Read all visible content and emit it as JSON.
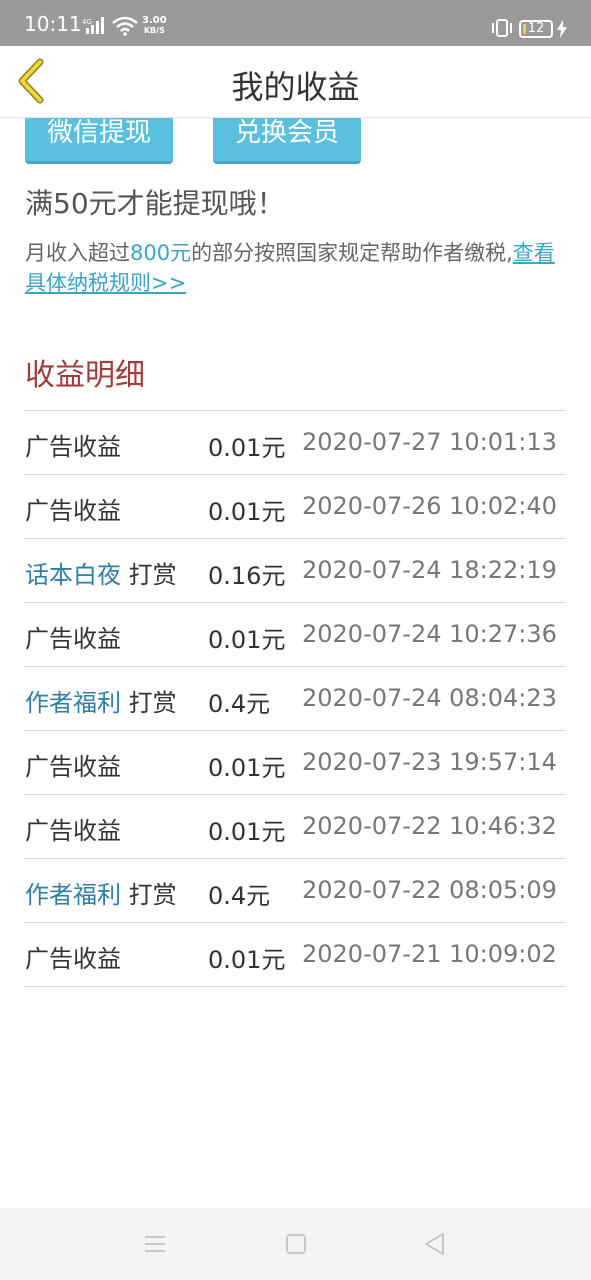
{
  "status_bar": {
    "time": "10:11",
    "network": "4G",
    "speed_value": "3.00",
    "speed_unit": "KB/S",
    "battery": "12"
  },
  "header": {
    "title": "我的收益"
  },
  "buttons": {
    "wechat_withdraw": "微信提现",
    "exchange_member": "兑换会员"
  },
  "min_note": "满50元才能提现哦！",
  "tax_note": {
    "prefix": "月收入超过",
    "amount": "800元",
    "middle": "的部分按照国家规定帮助作者缴税,",
    "link": "查看具体纳税规则>>"
  },
  "section_title": "收益明细",
  "rows": [
    {
      "name": "",
      "source": "广告收益",
      "amount": "0.01元",
      "time": "2020-07-27 10:01:13"
    },
    {
      "name": "",
      "source": "广告收益",
      "amount": "0.01元",
      "time": "2020-07-26 10:02:40"
    },
    {
      "name": "话本白夜",
      "source": " 打赏",
      "amount": "0.16元",
      "time": "2020-07-24 18:22:19"
    },
    {
      "name": "",
      "source": "广告收益",
      "amount": "0.01元",
      "time": "2020-07-24 10:27:36"
    },
    {
      "name": "作者福利",
      "source": " 打赏",
      "amount": "0.4元",
      "time": "2020-07-24 08:04:23"
    },
    {
      "name": "",
      "source": "广告收益",
      "amount": "0.01元",
      "time": "2020-07-23 19:57:14"
    },
    {
      "name": "",
      "source": "广告收益",
      "amount": "0.01元",
      "time": "2020-07-22 10:46:32"
    },
    {
      "name": "作者福利",
      "source": " 打赏",
      "amount": "0.4元",
      "time": "2020-07-22 08:05:09"
    },
    {
      "name": "",
      "source": "广告收益",
      "amount": "0.01元",
      "time": "2020-07-21 10:09:02"
    }
  ],
  "colors": {
    "accent": "#5bc0de",
    "section": "#a23b3b",
    "link": "#3aa4c4",
    "name": "#2e7fa6"
  },
  "icons": {
    "back": "chevron-left-icon",
    "menu": "menu-icon",
    "home": "square-icon",
    "nav_back": "triangle-back-icon"
  }
}
